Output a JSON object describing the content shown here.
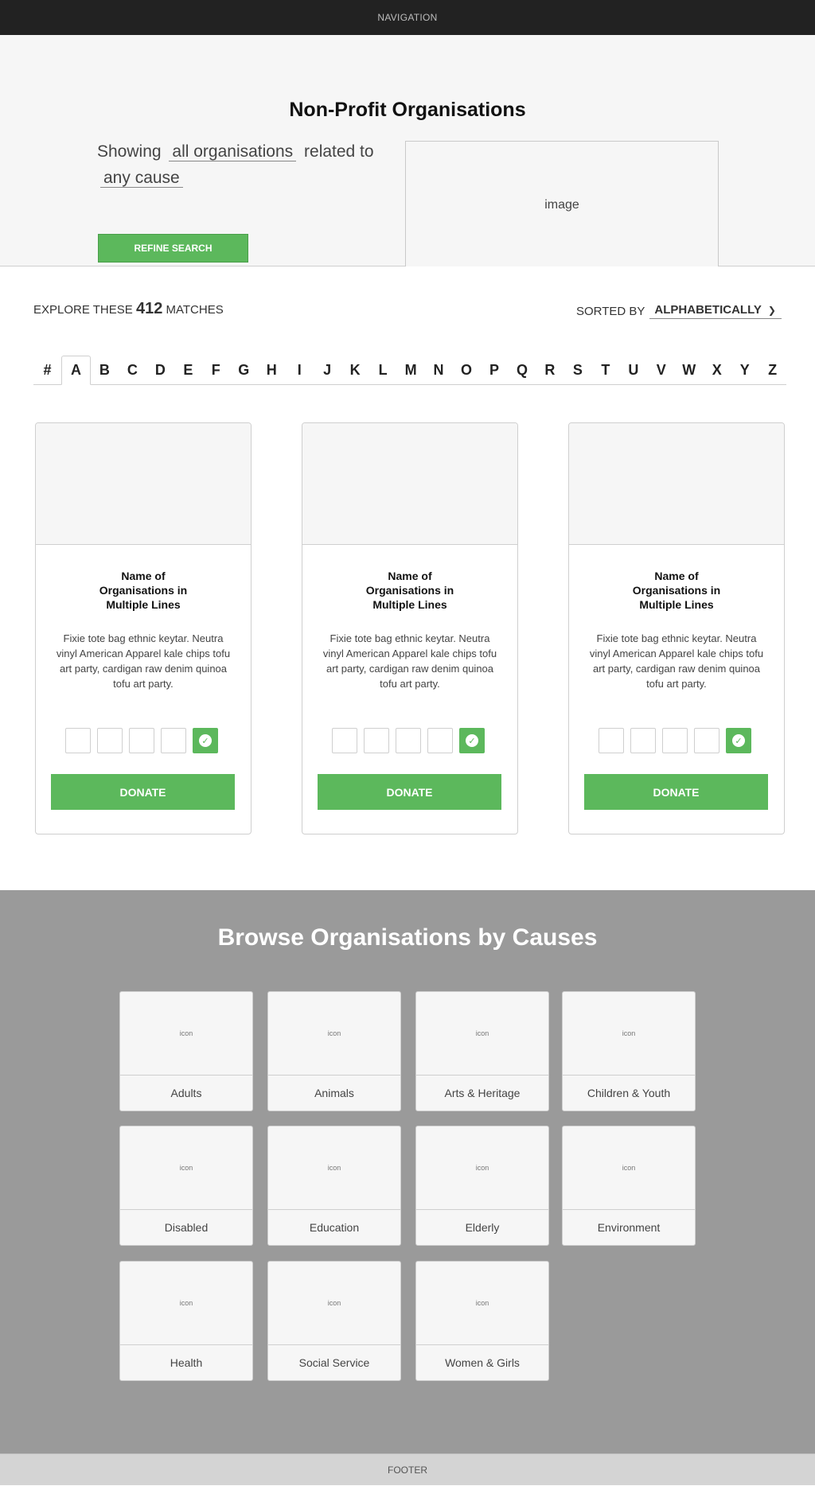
{
  "nav": {
    "label": "NAVIGATION"
  },
  "hero": {
    "title": "Non-Profit Organisations",
    "showing": "Showing",
    "org_filter": "all organisations",
    "related_to": "related to",
    "cause_filter": "any cause",
    "refine_label": "REFINE SEARCH",
    "image_label": "image"
  },
  "results": {
    "explore_prefix": "EXPLORE THESE",
    "count": "412",
    "explore_suffix": "MATCHES",
    "sorted_label": "SORTED BY",
    "sort_value": "ALPHABETICALLY",
    "letters": [
      "#",
      "A",
      "B",
      "C",
      "D",
      "E",
      "F",
      "G",
      "H",
      "I",
      "J",
      "K",
      "L",
      "M",
      "N",
      "O",
      "P",
      "Q",
      "R",
      "S",
      "T",
      "U",
      "V",
      "W",
      "X",
      "Y",
      "Z"
    ],
    "active_letter": "A",
    "cards": [
      {
        "name": "Name of Organisations in Multiple Lines",
        "desc": "Fixie tote bag ethnic keytar. Neutra vinyl American Apparel kale chips tofu art party, cardigan raw denim quinoa tofu art party.",
        "donate": "DONATE"
      },
      {
        "name": "Name of Organisations in Multiple Lines",
        "desc": "Fixie tote bag ethnic keytar. Neutra vinyl American Apparel kale chips tofu art party, cardigan raw denim quinoa tofu art party.",
        "donate": "DONATE"
      },
      {
        "name": "Name of Organisations in Multiple Lines",
        "desc": "Fixie tote bag ethnic keytar. Neutra vinyl American Apparel kale chips tofu art party, cardigan raw denim quinoa tofu art party.",
        "donate": "DONATE"
      }
    ]
  },
  "causes": {
    "title": "Browse Organisations by Causes",
    "icon_label": "icon",
    "items": [
      "Adults",
      "Animals",
      "Arts & Heritage",
      "Children & Youth",
      "Disabled",
      "Education",
      "Elderly",
      "Environment",
      "Health",
      "Social Service",
      "Women & Girls"
    ]
  },
  "footer": {
    "label": "FOOTER"
  },
  "colors": {
    "accent": "#5cb85c",
    "nav": "#222222",
    "causes_bg": "#9a9a9a"
  }
}
